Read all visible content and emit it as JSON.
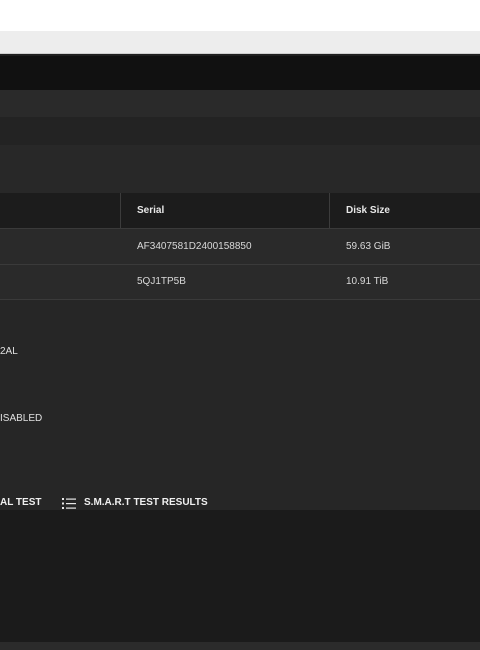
{
  "colors": {
    "app_background": "#1f1f1f",
    "header_row": "#1c1c1c",
    "body_row": "#2a2a2a",
    "text": "#d9d9d9"
  },
  "disk_table": {
    "headers": {
      "serial": "Serial",
      "disk_size": "Disk Size"
    },
    "rows": [
      {
        "serial": "AF3407581D2400158850",
        "disk_size": "59.63 GiB"
      },
      {
        "serial": "5QJ1TP5B",
        "disk_size": "10.91 TiB"
      }
    ]
  },
  "details": {
    "model_fragment": "2AL",
    "status_fragment": "ISABLED"
  },
  "actions": {
    "manual_test_fragment": "AL TEST",
    "smart_results_label": "S.M.A.R.T TEST RESULTS",
    "smart_results_icon": "list-icon"
  }
}
